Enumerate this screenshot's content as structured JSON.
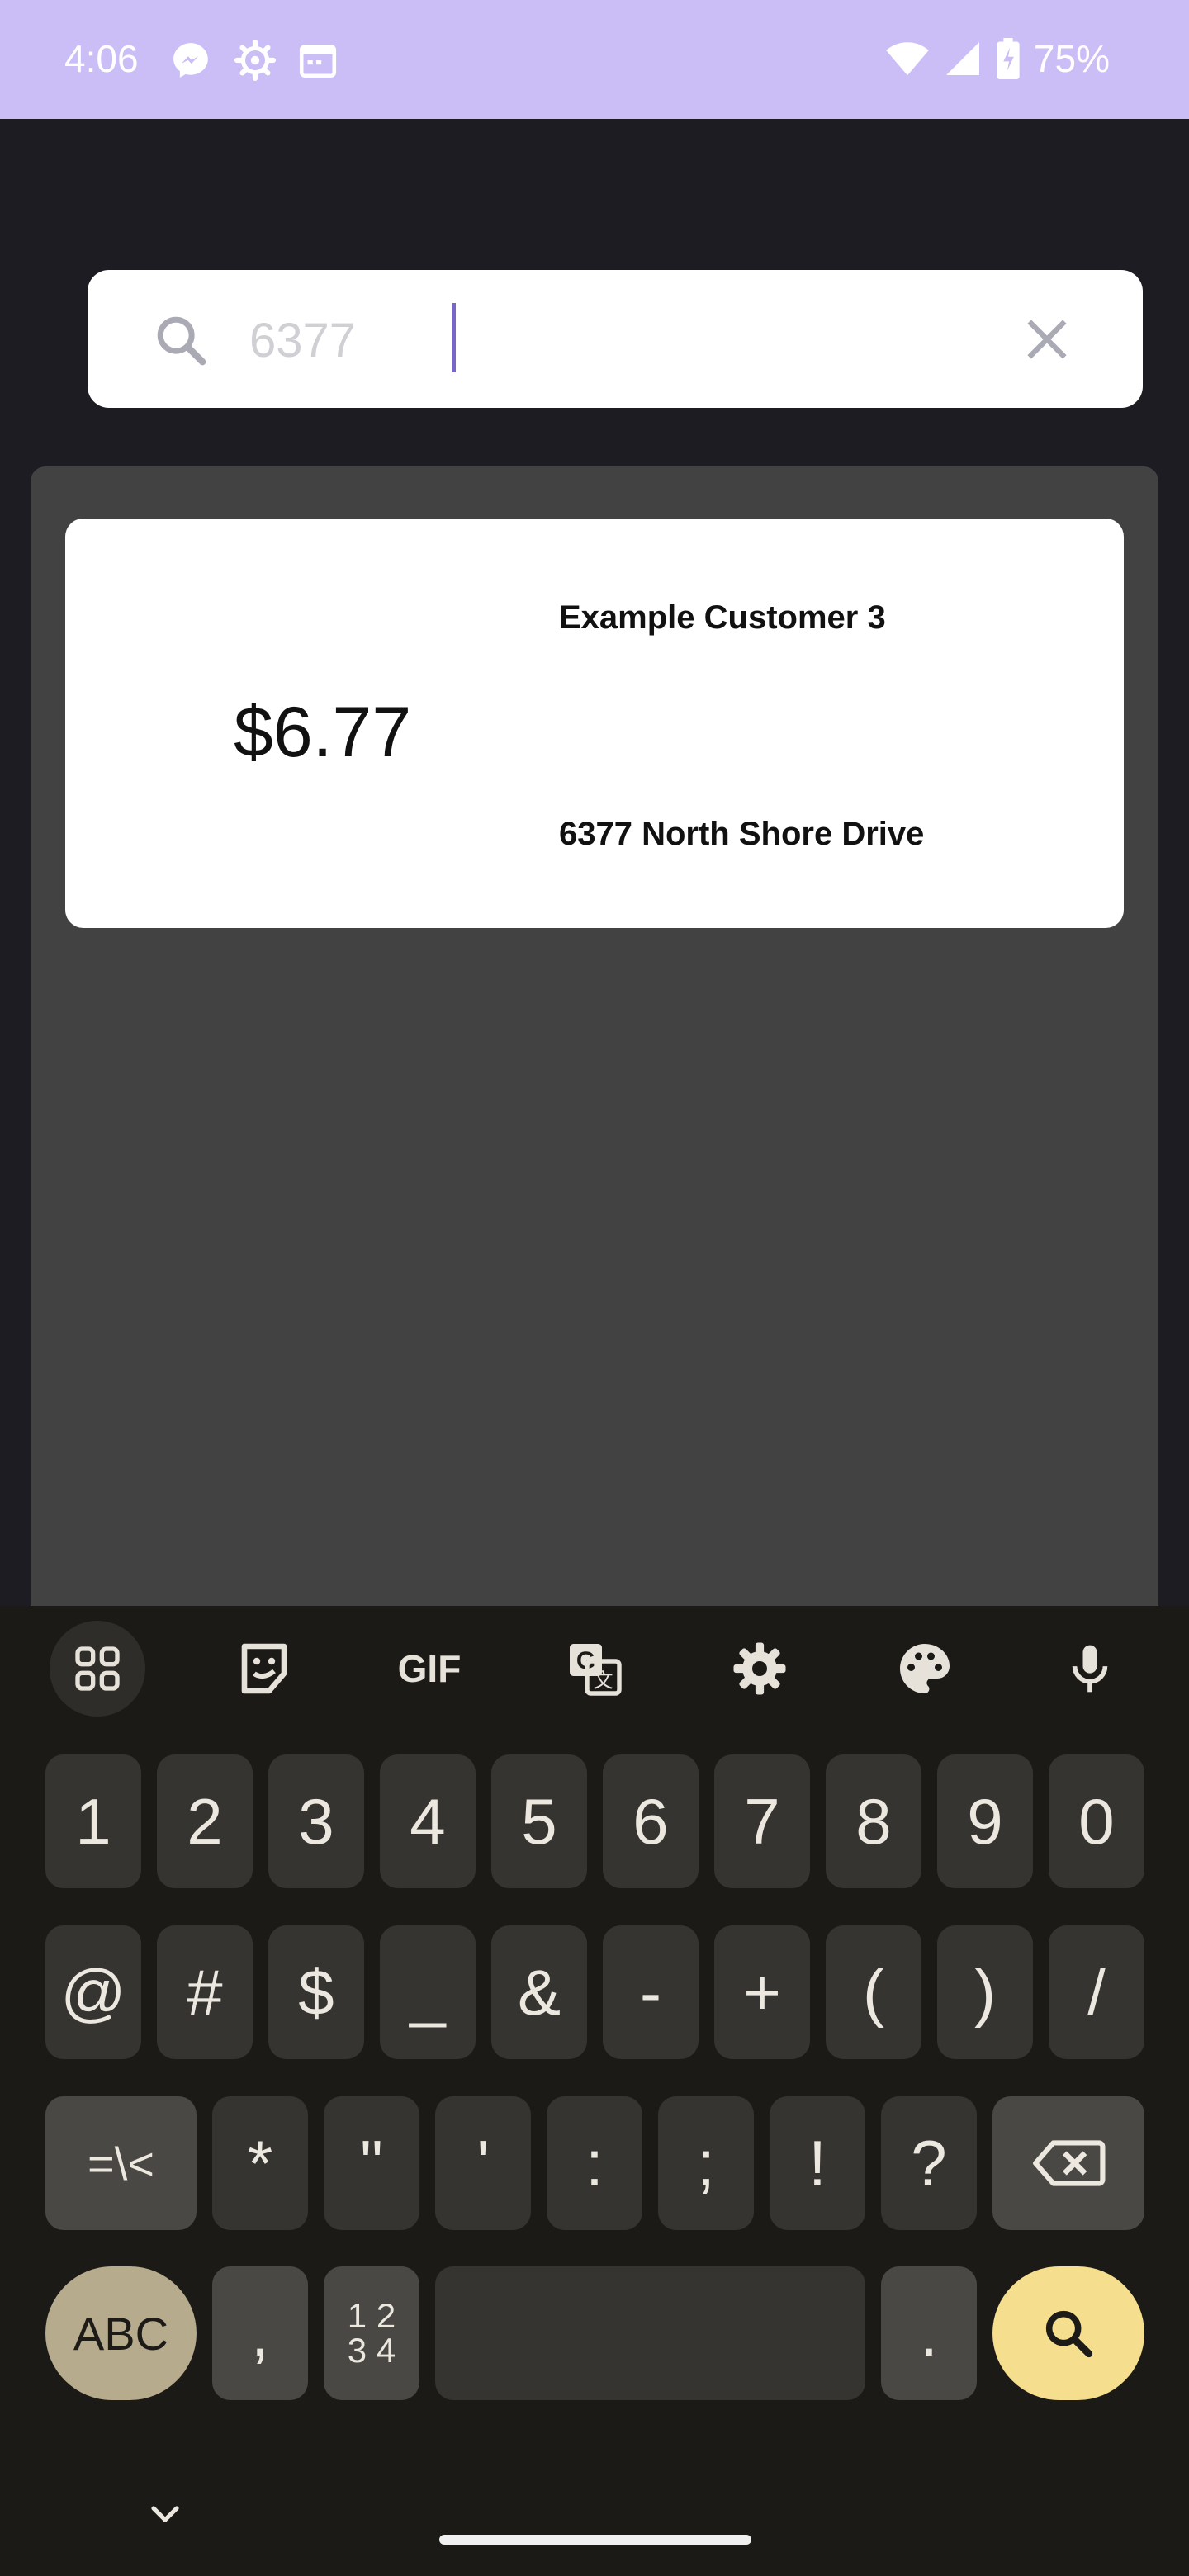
{
  "status_bar": {
    "time": "4:06",
    "battery": "75%",
    "icons": [
      "messenger-icon",
      "settings-gear-icon",
      "calendar-icon",
      "wifi-icon",
      "signal-icon",
      "battery-charging-icon"
    ],
    "background": "#cbbdf5"
  },
  "search": {
    "value": "6377",
    "icons": [
      "search-icon",
      "clear-icon"
    ]
  },
  "results": [
    {
      "price": "$6.77",
      "customer": "Example Customer 3",
      "address": "6377 North Shore Drive"
    }
  ],
  "keyboard": {
    "toolbar": [
      "apps-grid-icon",
      "sticker-icon",
      "GIF",
      "translate-icon",
      "settings-icon",
      "palette-icon",
      "microphone-icon"
    ],
    "gif_label": "GIF",
    "row1": [
      "1",
      "2",
      "3",
      "4",
      "5",
      "6",
      "7",
      "8",
      "9",
      "0"
    ],
    "row2": [
      "@",
      "#",
      "$",
      "_",
      "&",
      "-",
      "+",
      "(",
      ")",
      "/"
    ],
    "row3": [
      "=\\<",
      "*",
      "\"",
      "'",
      ":",
      ";",
      "!",
      "?"
    ],
    "abc_label": "ABC",
    "comma": ",",
    "numpad_label_top": "1 2",
    "numpad_label_bottom": "3 4",
    "period": ".",
    "accent": "#f5df8e"
  }
}
